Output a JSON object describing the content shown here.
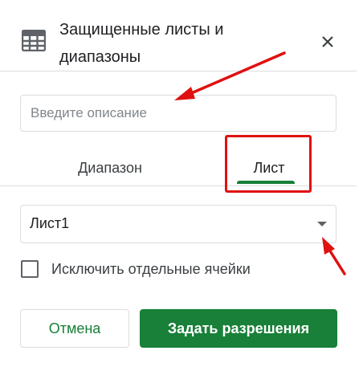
{
  "dialog": {
    "title": "Защищенные листы и диапазоны",
    "icons": {
      "sheet": "sheet-grid-icon",
      "close": "close-icon"
    }
  },
  "description_input": {
    "value": "",
    "placeholder": "Введите описание"
  },
  "tabs": [
    {
      "label": "Диапазон",
      "active": false
    },
    {
      "label": "Лист",
      "active": true
    }
  ],
  "sheet_select": {
    "selected": "Лист1",
    "icon": "dropdown-caret-icon"
  },
  "except_cells": {
    "label": "Исключить отдельные ячейки",
    "checked": false
  },
  "buttons": {
    "cancel": "Отмена",
    "set_permissions": "Задать разрешения"
  },
  "colors": {
    "accent": "#188038",
    "annotation": "#e01010",
    "border": "#dadce0"
  }
}
